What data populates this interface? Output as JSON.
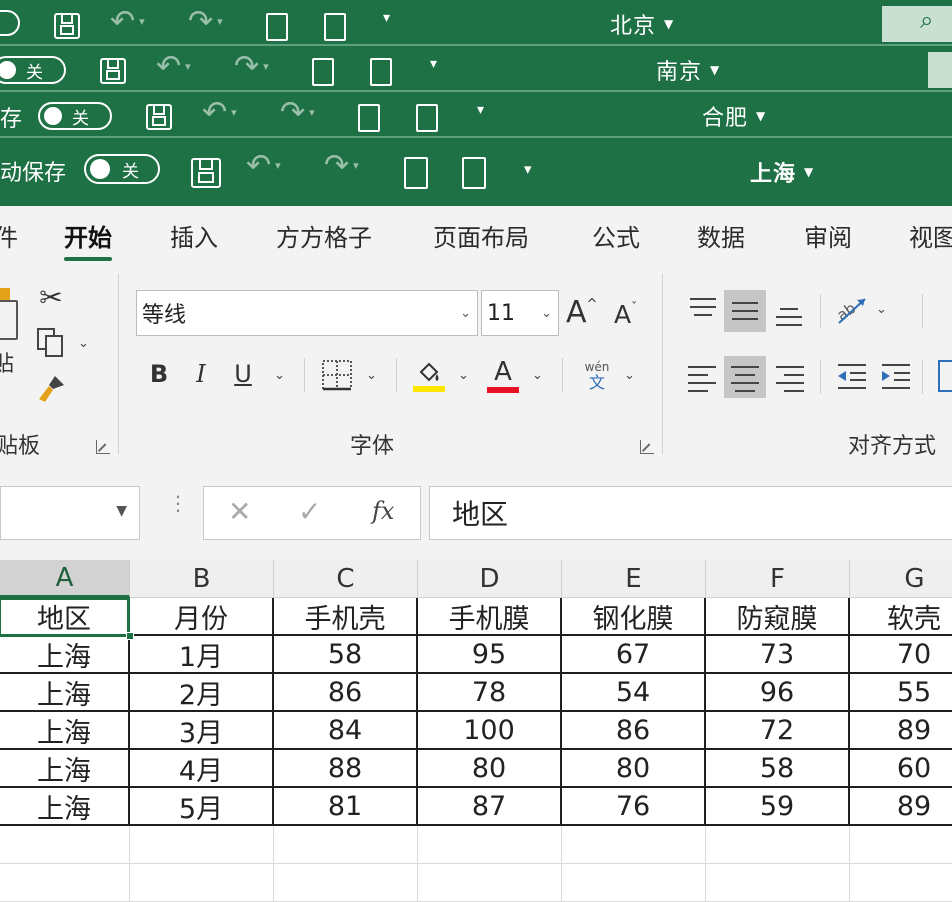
{
  "title_bars": [
    {
      "workbook": "北京",
      "autosave_state": ""
    },
    {
      "workbook": "南京",
      "autosave_state": "关"
    },
    {
      "workbook": "合肥",
      "autosave_state": "关",
      "autosave_label": "存"
    },
    {
      "workbook": "上海",
      "autosave_state": "关",
      "autosave_label": "动保存"
    }
  ],
  "ribbon_tabs": [
    {
      "label": "件"
    },
    {
      "label": "开始"
    },
    {
      "label": "插入"
    },
    {
      "label": "方方格子"
    },
    {
      "label": "页面布局"
    },
    {
      "label": "公式"
    },
    {
      "label": "数据"
    },
    {
      "label": "审阅"
    },
    {
      "label": "视图"
    }
  ],
  "active_tab": "开始",
  "clipboard": {
    "paste_label": "贴",
    "group_label": "贴板"
  },
  "font": {
    "name": "等线",
    "size": "11",
    "grow_label": "A",
    "shrink_label": "A",
    "bold": "B",
    "italic": "I",
    "underline": "U",
    "font_color_glyph": "A",
    "phonetic_top": "wén",
    "phonetic_bottom": "文",
    "fill_color": "#ffe600",
    "font_color": "#e81123",
    "group_label": "字体"
  },
  "alignment": {
    "group_label": "对齐方式"
  },
  "formula_bar": {
    "fx_label": "fx",
    "content": "地区"
  },
  "columns": [
    "A",
    "B",
    "C",
    "D",
    "E",
    "F",
    "G"
  ],
  "table": {
    "headers": [
      "地区",
      "月份",
      "手机壳",
      "手机膜",
      "钢化膜",
      "防窥膜",
      "软壳"
    ],
    "rows": [
      [
        "上海",
        "1月",
        "58",
        "95",
        "67",
        "73",
        "70"
      ],
      [
        "上海",
        "2月",
        "86",
        "78",
        "54",
        "96",
        "55"
      ],
      [
        "上海",
        "3月",
        "84",
        "100",
        "86",
        "72",
        "89"
      ],
      [
        "上海",
        "4月",
        "88",
        "80",
        "80",
        "58",
        "60"
      ],
      [
        "上海",
        "5月",
        "81",
        "87",
        "76",
        "59",
        "89"
      ]
    ]
  },
  "accent_color": "#1e7145"
}
